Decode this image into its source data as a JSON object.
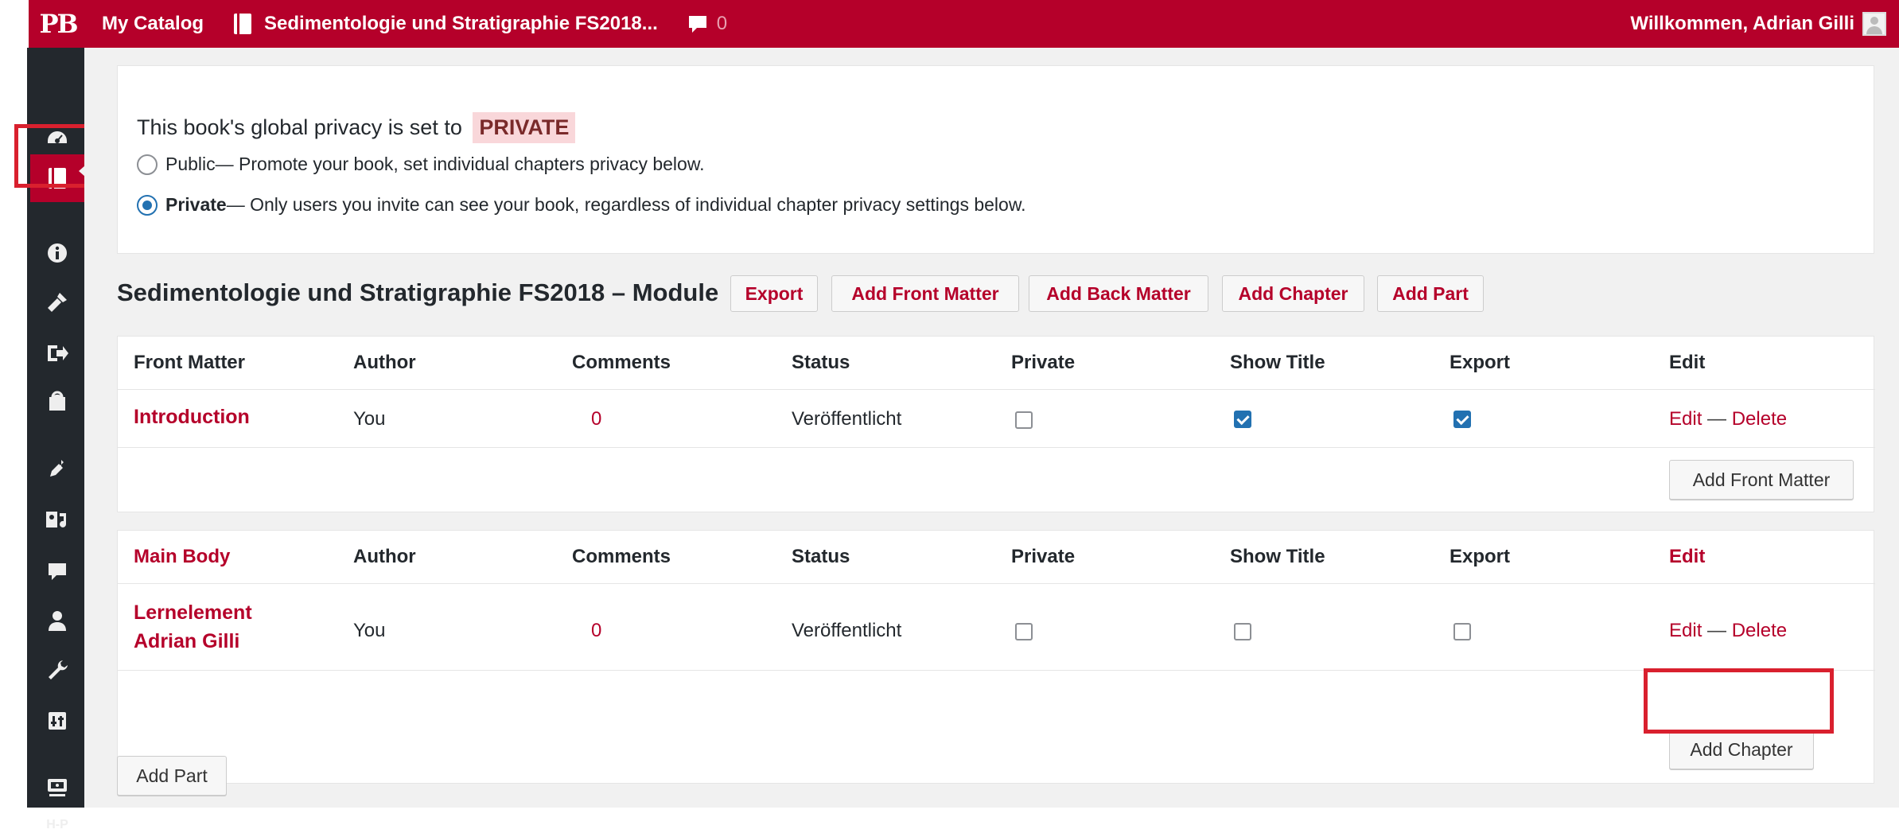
{
  "topbar": {
    "logo": "PB",
    "my_catalog": "My Catalog",
    "book_title": "Sedimentologie und Stratigraphie FS2018...",
    "comment_count": "0",
    "welcome": "Willkommen, Adrian Gilli"
  },
  "sidebar": {
    "icons": [
      "dashboard-icon",
      "book-icon",
      "info-icon",
      "appearance-icon",
      "export-icon",
      "publish-icon",
      "plugins-icon",
      "media-icon",
      "comments-icon",
      "users-icon",
      "tools-icon",
      "settings-icon",
      "presentation-icon",
      "h5p-icon"
    ],
    "h5p_label": "H-P"
  },
  "privacy": {
    "intro": "This book's global privacy is set to",
    "status": "PRIVATE",
    "public_label": "Public",
    "public_desc": " — Promote your book, set individual chapters privacy below.",
    "private_label": "Private",
    "private_desc": " — Only users you invite can see your book, regardless of individual chapter privacy settings below."
  },
  "book": {
    "title": "Sedimentologie und Stratigraphie FS2018 – Module",
    "buttons": [
      "Export",
      "Add Front Matter",
      "Add Back Matter",
      "Add Chapter",
      "Add Part"
    ]
  },
  "front_matter": {
    "headers": [
      "Front Matter",
      "Author",
      "Comments",
      "Status",
      "Private",
      "Show Title",
      "Export",
      "Edit"
    ],
    "row": {
      "title": "Introduction",
      "author": "You",
      "comments": "0",
      "status": "Veröffentlicht",
      "private": false,
      "show_title": true,
      "export": true,
      "edit": "Edit",
      "dash": " — ",
      "delete": "Delete"
    },
    "add_button": "Add Front Matter"
  },
  "main_body": {
    "headers": [
      "Main Body",
      "Author",
      "Comments",
      "Status",
      "Private",
      "Show Title",
      "Export",
      "Edit"
    ],
    "row": {
      "title_line1": "Lernelement",
      "title_line2": "Adrian Gilli",
      "author": "You",
      "comments": "0",
      "status": "Veröffentlicht",
      "private": false,
      "show_title": false,
      "export": false,
      "edit": "Edit",
      "dash": " — ",
      "delete": "Delete"
    },
    "add_button": "Add Chapter"
  },
  "add_part_button": "Add Part",
  "colors": {
    "brand": "#b5002a",
    "sidebar": "#23282d",
    "highlight": "#d9202e",
    "checkbox": "#2271b1"
  }
}
